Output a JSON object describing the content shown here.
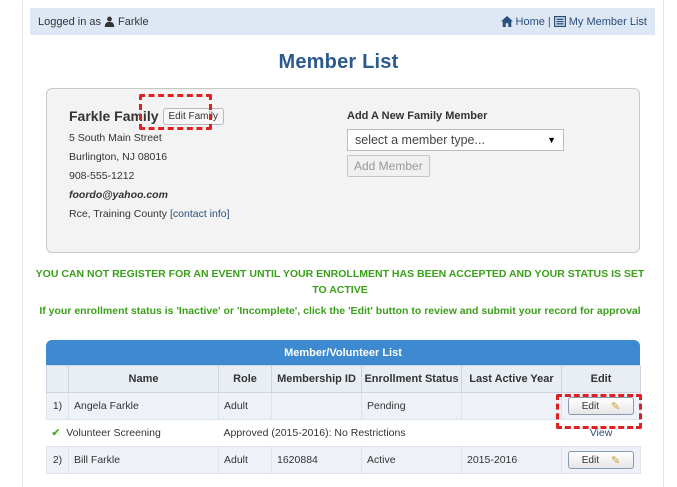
{
  "topbar": {
    "logged_in_prefix": "Logged in as",
    "user": "Farkle",
    "home": "Home",
    "separator": "|",
    "member_list": "My Member List"
  },
  "page_title": "Member List",
  "family": {
    "name": "Farkle Family",
    "edit_button": "Edit Family",
    "address1": "5 South Main Street",
    "address2": "Burlington, NJ 08016",
    "phone": "908-555-1212",
    "email": "foordo@yahoo.com",
    "role_county": "Rce, Training County",
    "contact_link": "[contact info]"
  },
  "add_member": {
    "title": "Add A New Family Member",
    "select_value": "select a member type...",
    "button": "Add Member"
  },
  "warning": {
    "line1": "YOU CAN NOT REGISTER FOR AN EVENT UNTIL YOUR ENROLLMENT HAS BEEN ACCEPTED AND YOUR STATUS IS SET TO ACTIVE",
    "line2": "If your enrollment status is 'Inactive' or 'Incomplete', click the 'Edit' button to review and submit your record for approval"
  },
  "table": {
    "title": "Member/Volunteer List",
    "columns": [
      "",
      "Name",
      "Role",
      "Membership ID",
      "Enrollment Status",
      "Last Active Year",
      "Edit"
    ],
    "rows": [
      {
        "num": "1)",
        "name": "Angela Farkle",
        "role": "Adult",
        "membership_id": "",
        "status": "Pending",
        "last_year": "",
        "edit": "Edit"
      },
      {
        "num": "2)",
        "name": "Bill Farkle",
        "role": "Adult",
        "membership_id": "1620884",
        "status": "Active",
        "last_year": "2015-2016",
        "edit": "Edit"
      }
    ],
    "screening": {
      "label": "Volunteer Screening",
      "status": "Approved (2015-2016): No Restrictions",
      "view": "View"
    }
  },
  "colors": {
    "title": "#2c5a8f",
    "warning": "#3aa01a",
    "table_header": "#3d8ad0",
    "highlight": "#e02020"
  }
}
